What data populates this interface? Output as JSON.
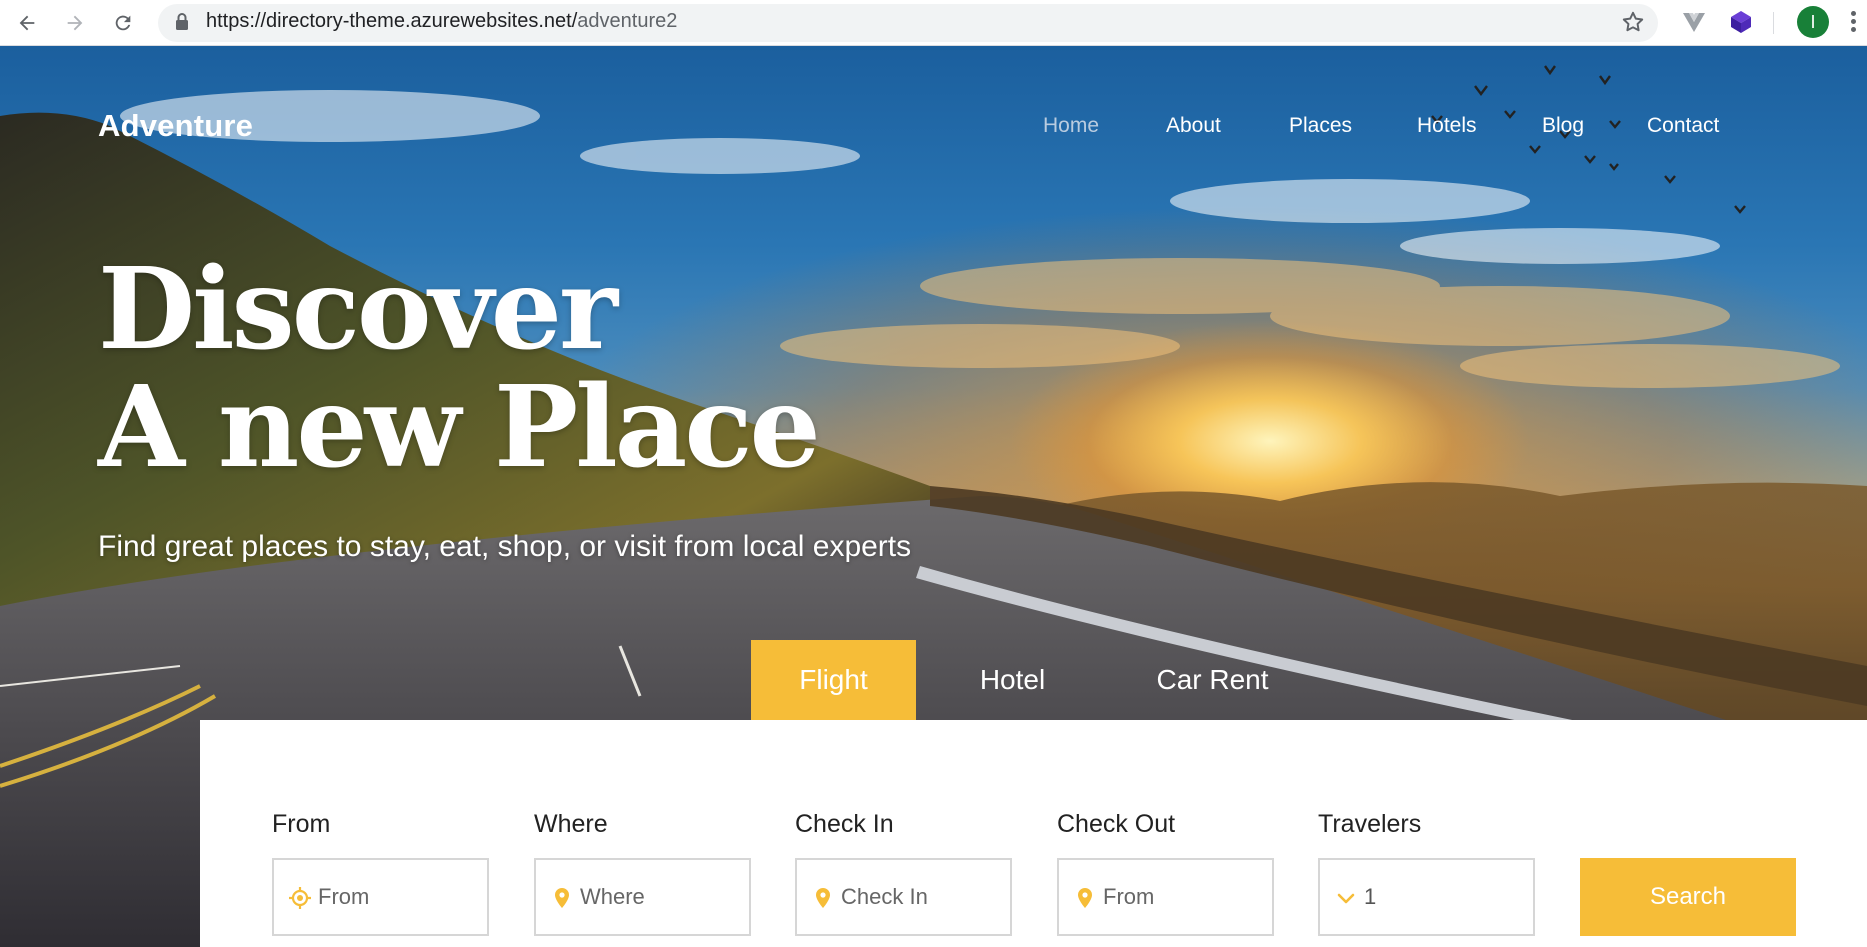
{
  "browser": {
    "url_host": "https://directory-theme.azurewebsites.net/",
    "url_path": "adventure2",
    "profile_initial": "I",
    "icons": [
      "back-icon",
      "forward-icon",
      "reload-icon",
      "lock-icon",
      "star-icon",
      "vue-extension-icon",
      "cube-extension-icon",
      "menu-kebab-icon"
    ]
  },
  "site": {
    "brand": "Adventure",
    "nav": [
      {
        "label": "Home",
        "active": true
      },
      {
        "label": "About"
      },
      {
        "label": "Places"
      },
      {
        "label": "Hotels"
      },
      {
        "label": "Blog"
      },
      {
        "label": "Contact"
      }
    ]
  },
  "hero": {
    "headline_line1": "Discover",
    "headline_line2": "A new Place",
    "subline": "Find great places to stay, eat, shop, or visit from local experts"
  },
  "tabs": [
    {
      "label": "Flight",
      "active": true
    },
    {
      "label": "Hotel"
    },
    {
      "label": "Car Rent"
    }
  ],
  "search": {
    "fields": [
      {
        "label": "From",
        "placeholder": "From",
        "icon": "crosshair-icon"
      },
      {
        "label": "Where",
        "placeholder": "Where",
        "icon": "map-pin-icon"
      },
      {
        "label": "Check In",
        "placeholder": "Check In",
        "icon": "map-pin-icon"
      },
      {
        "label": "Check Out",
        "placeholder": "From",
        "icon": "map-pin-icon"
      },
      {
        "label": "Travelers",
        "value": "1",
        "icon": "chevron-down-icon"
      }
    ],
    "button_label": "Search"
  },
  "colors": {
    "accent": "#f6bd38",
    "nav_active": "#b9cce0",
    "field_border": "#d6d6d6"
  }
}
